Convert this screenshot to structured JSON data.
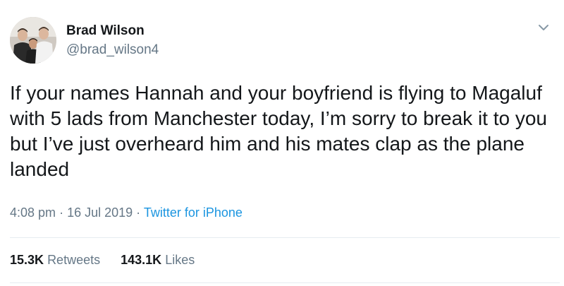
{
  "author": {
    "name": "Brad Wilson",
    "handle": "@brad_wilson4"
  },
  "tweet": {
    "text": "If your names Hannah and your boyfriend is flying to Magaluf with 5 lads from Manchester today, I’m sorry to break it to you but I’ve just overheard him and his mates clap as the plane landed",
    "time": "4:08 pm",
    "separator": "·",
    "date": "16 Jul 2019",
    "source": "Twitter for iPhone"
  },
  "stats": {
    "retweets_count": "15.3K",
    "retweets_label": "Retweets",
    "likes_count": "143.1K",
    "likes_label": "Likes"
  },
  "icons": {
    "menu": "chevron-down-icon"
  },
  "colors": {
    "text": "#14171a",
    "secondary": "#657786",
    "link": "#1b95e0",
    "divider": "#e6ecf0"
  }
}
